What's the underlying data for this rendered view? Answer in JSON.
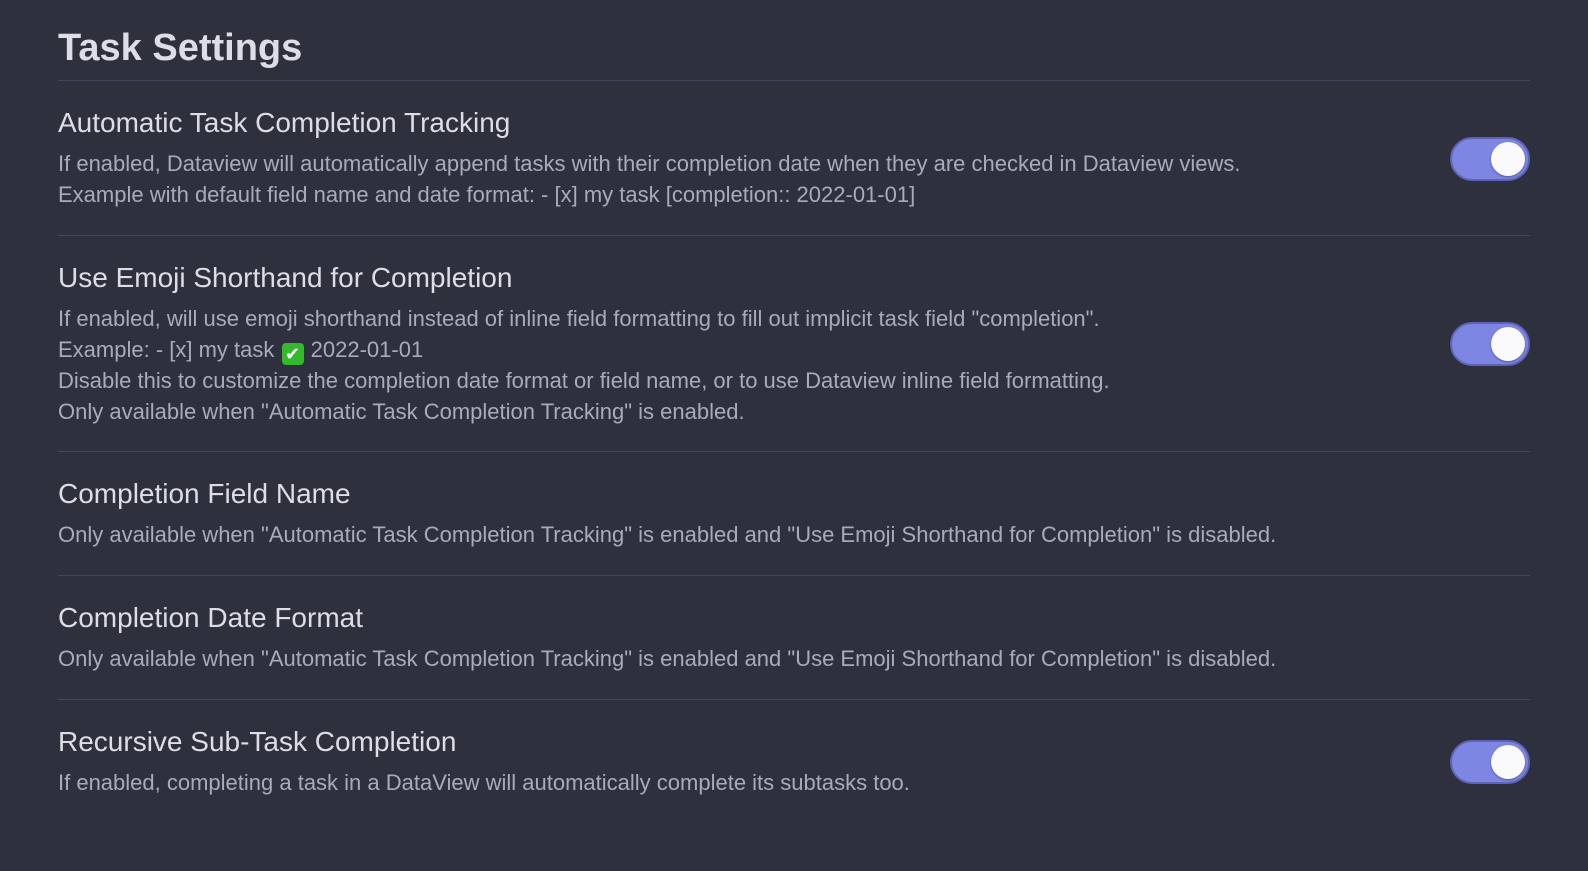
{
  "page": {
    "title": "Task Settings"
  },
  "settings": [
    {
      "name": "Automatic Task Completion Tracking",
      "desc": [
        "If enabled, Dataview will automatically append tasks with their completion date when they are checked in Dataview views.",
        "Example with default field name and date format: - [x] my task [completion:: 2022-01-01]"
      ],
      "toggle": true
    },
    {
      "name": "Use Emoji Shorthand for Completion",
      "desc_line1": "If enabled, will use emoji shorthand instead of inline field formatting to fill out implicit task field \"completion\".",
      "desc_line2_prefix": "Example: - [x] my task",
      "desc_line2_emoji": "✔",
      "desc_line2_suffix": "2022-01-01",
      "desc_line3": "Disable this to customize the completion date format or field name, or to use Dataview inline field formatting.",
      "desc_line4": "Only available when \"Automatic Task Completion Tracking\" is enabled.",
      "toggle": true
    },
    {
      "name": "Completion Field Name",
      "desc": [
        "Only available when \"Automatic Task Completion Tracking\" is enabled and \"Use Emoji Shorthand for Completion\" is disabled."
      ]
    },
    {
      "name": "Completion Date Format",
      "desc": [
        "Only available when \"Automatic Task Completion Tracking\" is enabled and \"Use Emoji Shorthand for Completion\" is disabled."
      ]
    },
    {
      "name": "Recursive Sub-Task Completion",
      "desc": [
        "If enabled, completing a task in a DataView will automatically complete its subtasks too."
      ],
      "toggle": true
    }
  ],
  "icons": {
    "emoji_check": "check-mark-button-emoji"
  },
  "colors": {
    "background": "#2e303d",
    "toggle_on": "#7e86e3",
    "divider": "#43465a",
    "emoji_green": "#35b82b"
  }
}
